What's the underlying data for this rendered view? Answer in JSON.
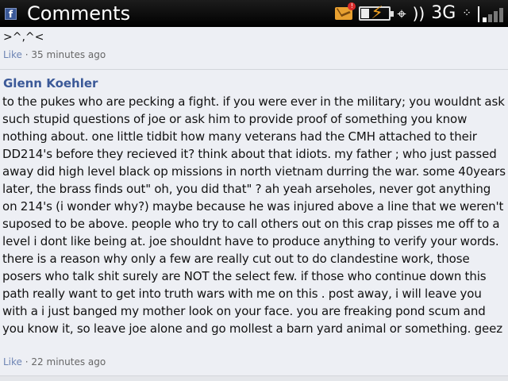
{
  "app": {
    "title": "Comments",
    "logo_letter": "f"
  },
  "status_bar": {
    "network": "3G",
    "mail_badge": "!",
    "icons": [
      "mail-icon",
      "battery-charging-icon",
      "gps-icon",
      "blackberry-icon",
      "signal-icon"
    ]
  },
  "previous_comment": {
    "text_fragment": ">^,^<",
    "like_label": "Like",
    "separator": "·",
    "time": "35 minutes ago"
  },
  "comment": {
    "author": "Glenn Koehler",
    "text": "to the pukes who are pecking a fight. if you were ever in the military; you wouldnt ask such stupid questions of joe or ask him to provide proof of something you know nothing about. one little tidbit how many veterans had the CMH attached to their DD214's before they recieved it? think about that idiots. my father ; who just passed away did high level black op missions in north vietnam durring the war. some 40years later, the brass finds out\" oh, you did that\" ? ah yeah arseholes, never got anything on 214's (i wonder why?) maybe because he was injured above a line that we weren't suposed to be above. people who try to call others out on this crap pisses me off to a level i dont like being at. joe shouldnt have to produce anything to verify your words. there is a reason why only a few are really cut out to do clandestine work, those posers who talk shit surely are NOT the select few. if those who continue down this path really want to get into truth wars with me on this . post away, i will leave you with a i just banged my mother look on your face. you are freaking pond scum and you know it, so leave joe alone and go mollest a barn yard animal or something. geez",
    "like_label": "Like",
    "separator": "·",
    "time": "22 minutes ago"
  },
  "colors": {
    "link": "#3b5998",
    "like": "#6d84b4",
    "background": "#edeff4"
  }
}
